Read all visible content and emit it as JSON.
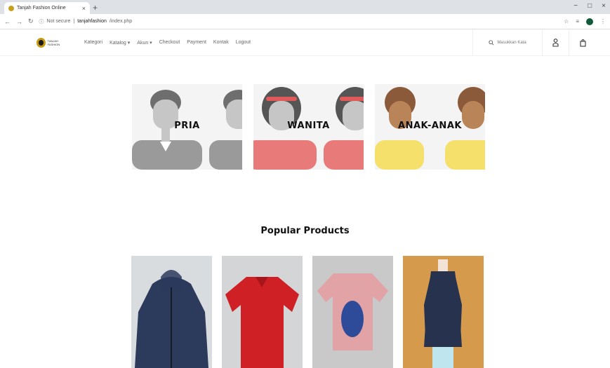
{
  "browser": {
    "tab_title": "Tanjah Fashion Online",
    "url_scheme": "Not secure",
    "url_host": "tanjahfashion",
    "url_path": "/index.php",
    "window_controls": [
      "−",
      "□",
      "×"
    ]
  },
  "header": {
    "logo_text": "TANJAH FASHION",
    "nav": [
      "Kategori",
      "Katalog ▾",
      "Akun ▾",
      "Checkout",
      "Payment",
      "Kontak",
      "Logout"
    ],
    "search_placeholder": "Masukkan Kata"
  },
  "categories": [
    {
      "label": "PRIA",
      "shirt_color": "#9a9a9a"
    },
    {
      "label": "WANITA",
      "shirt_color": "#e97a7a"
    },
    {
      "label": "ANAK-ANAK",
      "shirt_color": "#f4e06a"
    }
  ],
  "popular": {
    "title": "Popular Products",
    "items": [
      {
        "name": "navy-hoodie-jacket",
        "color": "#2c3a5c",
        "bg": "#d9dcdf"
      },
      {
        "name": "red-polo-shirt",
        "color": "#cf2026",
        "bg": "#d3d5d6"
      },
      {
        "name": "pink-tshirt",
        "color": "#e2a3a6",
        "bg": "#c9c9c9"
      },
      {
        "name": "navy-long-dress",
        "color": "#27324f",
        "bg": "#d59a4b"
      }
    ]
  }
}
